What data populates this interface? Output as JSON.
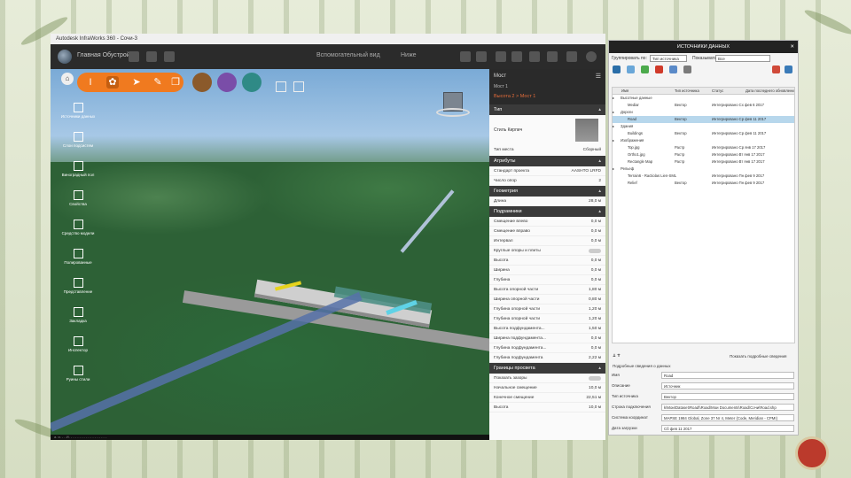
{
  "window": {
    "title": "Autodesk InfraWorks 360 - Сочи-3",
    "model_name": "Главная Обустрой",
    "center_labels": [
      "Вспомогательный вид",
      "Ниже"
    ]
  },
  "viewport": {
    "tools": [
      "Источники данных",
      "Слои подсистем",
      "Виноградный пол",
      "Свойства",
      "Средство модели",
      "Полированные",
      "Представление",
      "Закладка",
      "Инспектор",
      "Руины стили"
    ],
    "status": "а. и. - -  И. - - - - - - - - - - - - - - - - -"
  },
  "properties": {
    "title": "Мост",
    "subtitle": "Мост 1",
    "breadcrumb": "Высота 2  >  Мост 1",
    "sections": {
      "style": {
        "header": "Тип",
        "label": "Стиль Кирпич",
        "row_label": "Тип места",
        "row_value": "Сборный"
      },
      "attributes": {
        "header": "Атрибуты",
        "rows": [
          {
            "label": "Стандарт проекта",
            "value": "AASHTO LRFD"
          },
          {
            "label": "Число опор",
            "value": "2"
          }
        ]
      },
      "geometry": {
        "header": "Геометрия",
        "rows": [
          {
            "label": "Длина",
            "value": "28,0 м"
          }
        ]
      },
      "foundation": {
        "header": "Подрамники",
        "rows": [
          {
            "label": "Смещение влево",
            "value": "0,0 м"
          },
          {
            "label": "Смещение вправо",
            "value": "0,0 м"
          },
          {
            "label": "Интервал",
            "value": "0,0 м"
          },
          {
            "label": "Круглые опоры и плиты",
            "value": ""
          },
          {
            "label": "Высота",
            "value": "0,0 м"
          },
          {
            "label": "Ширина",
            "value": "0,0 м"
          },
          {
            "label": "Глубина",
            "value": "0,0 м"
          },
          {
            "label": "Высота опорной части",
            "value": "1,80 м"
          },
          {
            "label": "Ширина опорной части",
            "value": "0,80 м"
          },
          {
            "label": "Глубина опорной части",
            "value": "1,20 м"
          },
          {
            "label": "Глубина опорной части",
            "value": "1,20 м"
          },
          {
            "label": "Высота подфундамента...",
            "value": "1,50 м"
          },
          {
            "label": "Ширина подфундамента...",
            "value": "0,0 м"
          },
          {
            "label": "Глубина подфундамента...",
            "value": "0,0 м"
          },
          {
            "label": "Глубина подфундамента",
            "value": "2,22 м"
          }
        ]
      },
      "clearance": {
        "header": "Границы просвета",
        "rows": [
          {
            "label": "Показать зазоры",
            "value": ""
          },
          {
            "label": "Начальное смещение",
            "value": "10,0 м"
          },
          {
            "label": "Конечное смещение",
            "value": "22,51 м"
          },
          {
            "label": "Высота",
            "value": "10,0 м"
          }
        ]
      }
    }
  },
  "data_sources": {
    "title": "ИСТОЧНИКИ ДАННЫХ",
    "group_by_label": "Группировать по:",
    "group_by_value": "Тип источника",
    "filter_label": "Показывать:",
    "filter_value": "Все",
    "columns": [
      "Имя",
      "Тип источника",
      "Статус",
      "Дата последнего обновления"
    ],
    "rows": [
      {
        "name": "Высотные данные",
        "type": "",
        "status": "",
        "date": "",
        "level": 0,
        "selected": false
      },
      {
        "name": "Mediar",
        "type": "Вектор",
        "status": "Интегрировано Сх фев 6 2017",
        "date": "",
        "level": 1,
        "selected": false
      },
      {
        "name": "Дороги",
        "type": "",
        "status": "",
        "date": "",
        "level": 0,
        "selected": false
      },
      {
        "name": "Road",
        "type": "Вектор",
        "status": "Интегрировано Ср фев 11 2017",
        "date": "",
        "level": 1,
        "selected": true
      },
      {
        "name": "Здания",
        "type": "",
        "status": "",
        "date": "",
        "level": 0,
        "selected": false
      },
      {
        "name": "Buildings",
        "type": "Вектор",
        "status": "Интегрировано Ср фев 11 2017",
        "date": "",
        "level": 1,
        "selected": false
      },
      {
        "name": "Изображения",
        "type": "",
        "status": "",
        "date": "",
        "level": 0,
        "selected": false
      },
      {
        "name": "Top.jpg",
        "type": "Растр",
        "status": "Интегрировано Ср янв 17 2017",
        "date": "",
        "level": 1,
        "selected": false
      },
      {
        "name": "Ortho1.jpg",
        "type": "Растр",
        "status": "Интегрировано Вт янв 17 2017",
        "date": "",
        "level": 1,
        "selected": false
      },
      {
        "name": "Rectangle Map",
        "type": "Растр",
        "status": "Интегрировано Вт янв 17 2017",
        "date": "",
        "level": 1,
        "selected": false
      },
      {
        "name": "Рельеф",
        "type": "",
        "status": "",
        "date": "",
        "level": 0,
        "selected": false
      },
      {
        "name": "Terrain6 - Ractiolas Lien-SML",
        "type": "",
        "status": "Интегрировано Пн фев 9 2017",
        "date": "",
        "level": 1,
        "selected": false
      },
      {
        "name": "Relief",
        "type": "Вектор",
        "status": "Интегрировано Пн фев 9 2017",
        "date": "",
        "level": 1,
        "selected": false
      }
    ],
    "refresh_label": "Показать подробные сведения",
    "details_header": "Подробные сведения о данных",
    "form": [
      {
        "label": "Имя",
        "value": "Road"
      },
      {
        "label": "Описание",
        "value": "Источник"
      },
      {
        "label": "Тип источника",
        "value": "Вектор"
      },
      {
        "label": "Строка подключения",
        "value": "k\\Мои\\Dataset\\Road\\\\Road\\Мои Documents\\Road\\Сочи\\Road.shp"
      },
      {
        "label": "Система координат",
        "value": "MAPSE 1984 Global, Zone 37 Nr 4, Meter (Code, Meridian - CPMI)"
      },
      {
        "label": "Дата загрузки",
        "value": "Сб фев 11 2017"
      }
    ]
  },
  "colors": {
    "accent_orange": "#f07a1f",
    "purple": "#7a4da8",
    "teal": "#2f8a86",
    "brown": "#8b5a2b"
  }
}
